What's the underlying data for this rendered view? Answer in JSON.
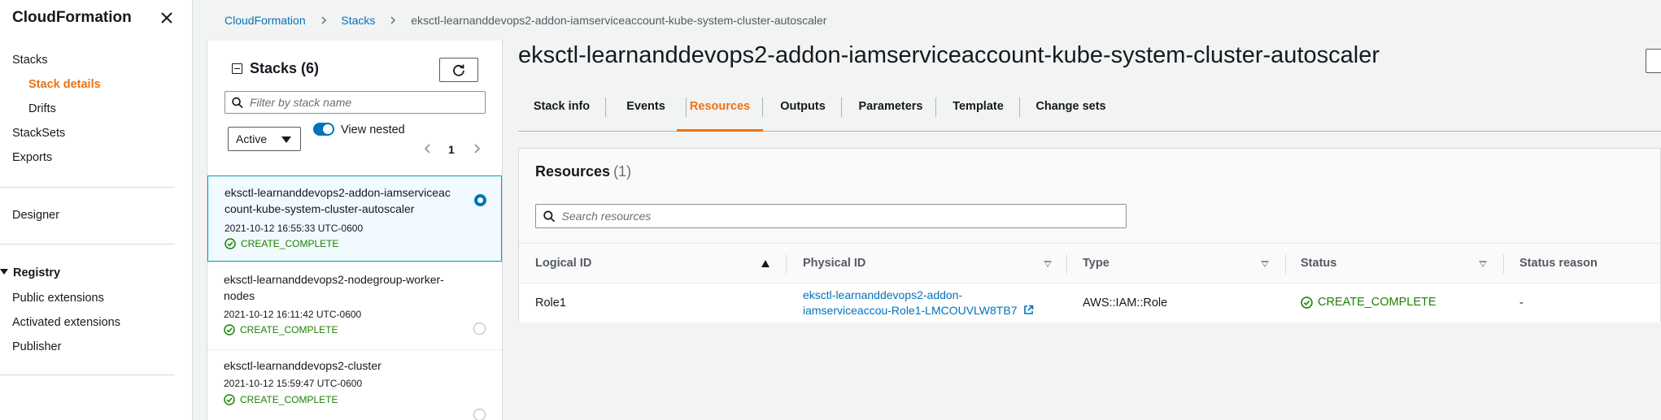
{
  "nav": {
    "title": "CloudFormation",
    "items": [
      {
        "label": "Stacks"
      },
      {
        "label": "Stack details"
      },
      {
        "label": "Drifts"
      },
      {
        "label": "StackSets"
      },
      {
        "label": "Exports"
      },
      {
        "label": "Designer"
      },
      {
        "label": "Registry"
      },
      {
        "label": "Public extensions"
      },
      {
        "label": "Activated extensions"
      },
      {
        "label": "Publisher"
      }
    ]
  },
  "breadcrumb": [
    "CloudFormation",
    "Stacks",
    "eksctl-learnanddevops2-addon-iamserviceaccount-kube-system-cluster-autoscaler"
  ],
  "stacks_panel": {
    "title": "Stacks",
    "count": "(6)",
    "filter_placeholder": "Filter by stack name",
    "status_filter": "Active",
    "view_nested_label": "View nested",
    "page": "1",
    "stacks": [
      {
        "name": "eksctl-learnanddevops2-addon-iamserviceaccount-kube-system-cluster-autoscaler",
        "line1": "eksctl-learnanddevops2-addon-iamserviceac",
        "line2": "count-kube-system-cluster-autoscaler",
        "timestamp": "2021-10-12 16:55:33 UTC-0600",
        "status": "CREATE_COMPLETE",
        "selected": true
      },
      {
        "name": "eksctl-learnanddevops2-nodegroup-worker-nodes",
        "line1": "eksctl-learnanddevops2-nodegroup-worker-",
        "line2": "nodes",
        "timestamp": "2021-10-12 16:11:42 UTC-0600",
        "status": "CREATE_COMPLETE",
        "selected": false
      },
      {
        "name": "eksctl-learnanddevops2-cluster",
        "line1": "eksctl-learnanddevops2-cluster",
        "line2": "",
        "timestamp": "2021-10-12 15:59:47 UTC-0600",
        "status": "CREATE_COMPLETE",
        "selected": false
      }
    ]
  },
  "page_title": "eksctl-learnanddevops2-addon-iamserviceaccount-kube-system-cluster-autoscaler",
  "tabs": [
    "Stack info",
    "Events",
    "Resources",
    "Outputs",
    "Parameters",
    "Template",
    "Change sets"
  ],
  "active_tab": "Resources",
  "resources": {
    "title": "Resources",
    "count": "(1)",
    "search_placeholder": "Search resources",
    "columns": [
      "Logical ID",
      "Physical ID",
      "Type",
      "Status",
      "Status reason"
    ],
    "rows": [
      {
        "logical_id": "Role1",
        "physical_id_line1": "eksctl-learnanddevops2-addon-",
        "physical_id_line2": "iamserviceaccou-Role1-LMCOUVLW8TB7",
        "type": "AWS::IAM::Role",
        "status": "CREATE_COMPLETE",
        "status_reason": "-"
      }
    ]
  },
  "colors": {
    "accent": "#ec7211",
    "link": "#0073bb",
    "success": "#1d8102"
  }
}
